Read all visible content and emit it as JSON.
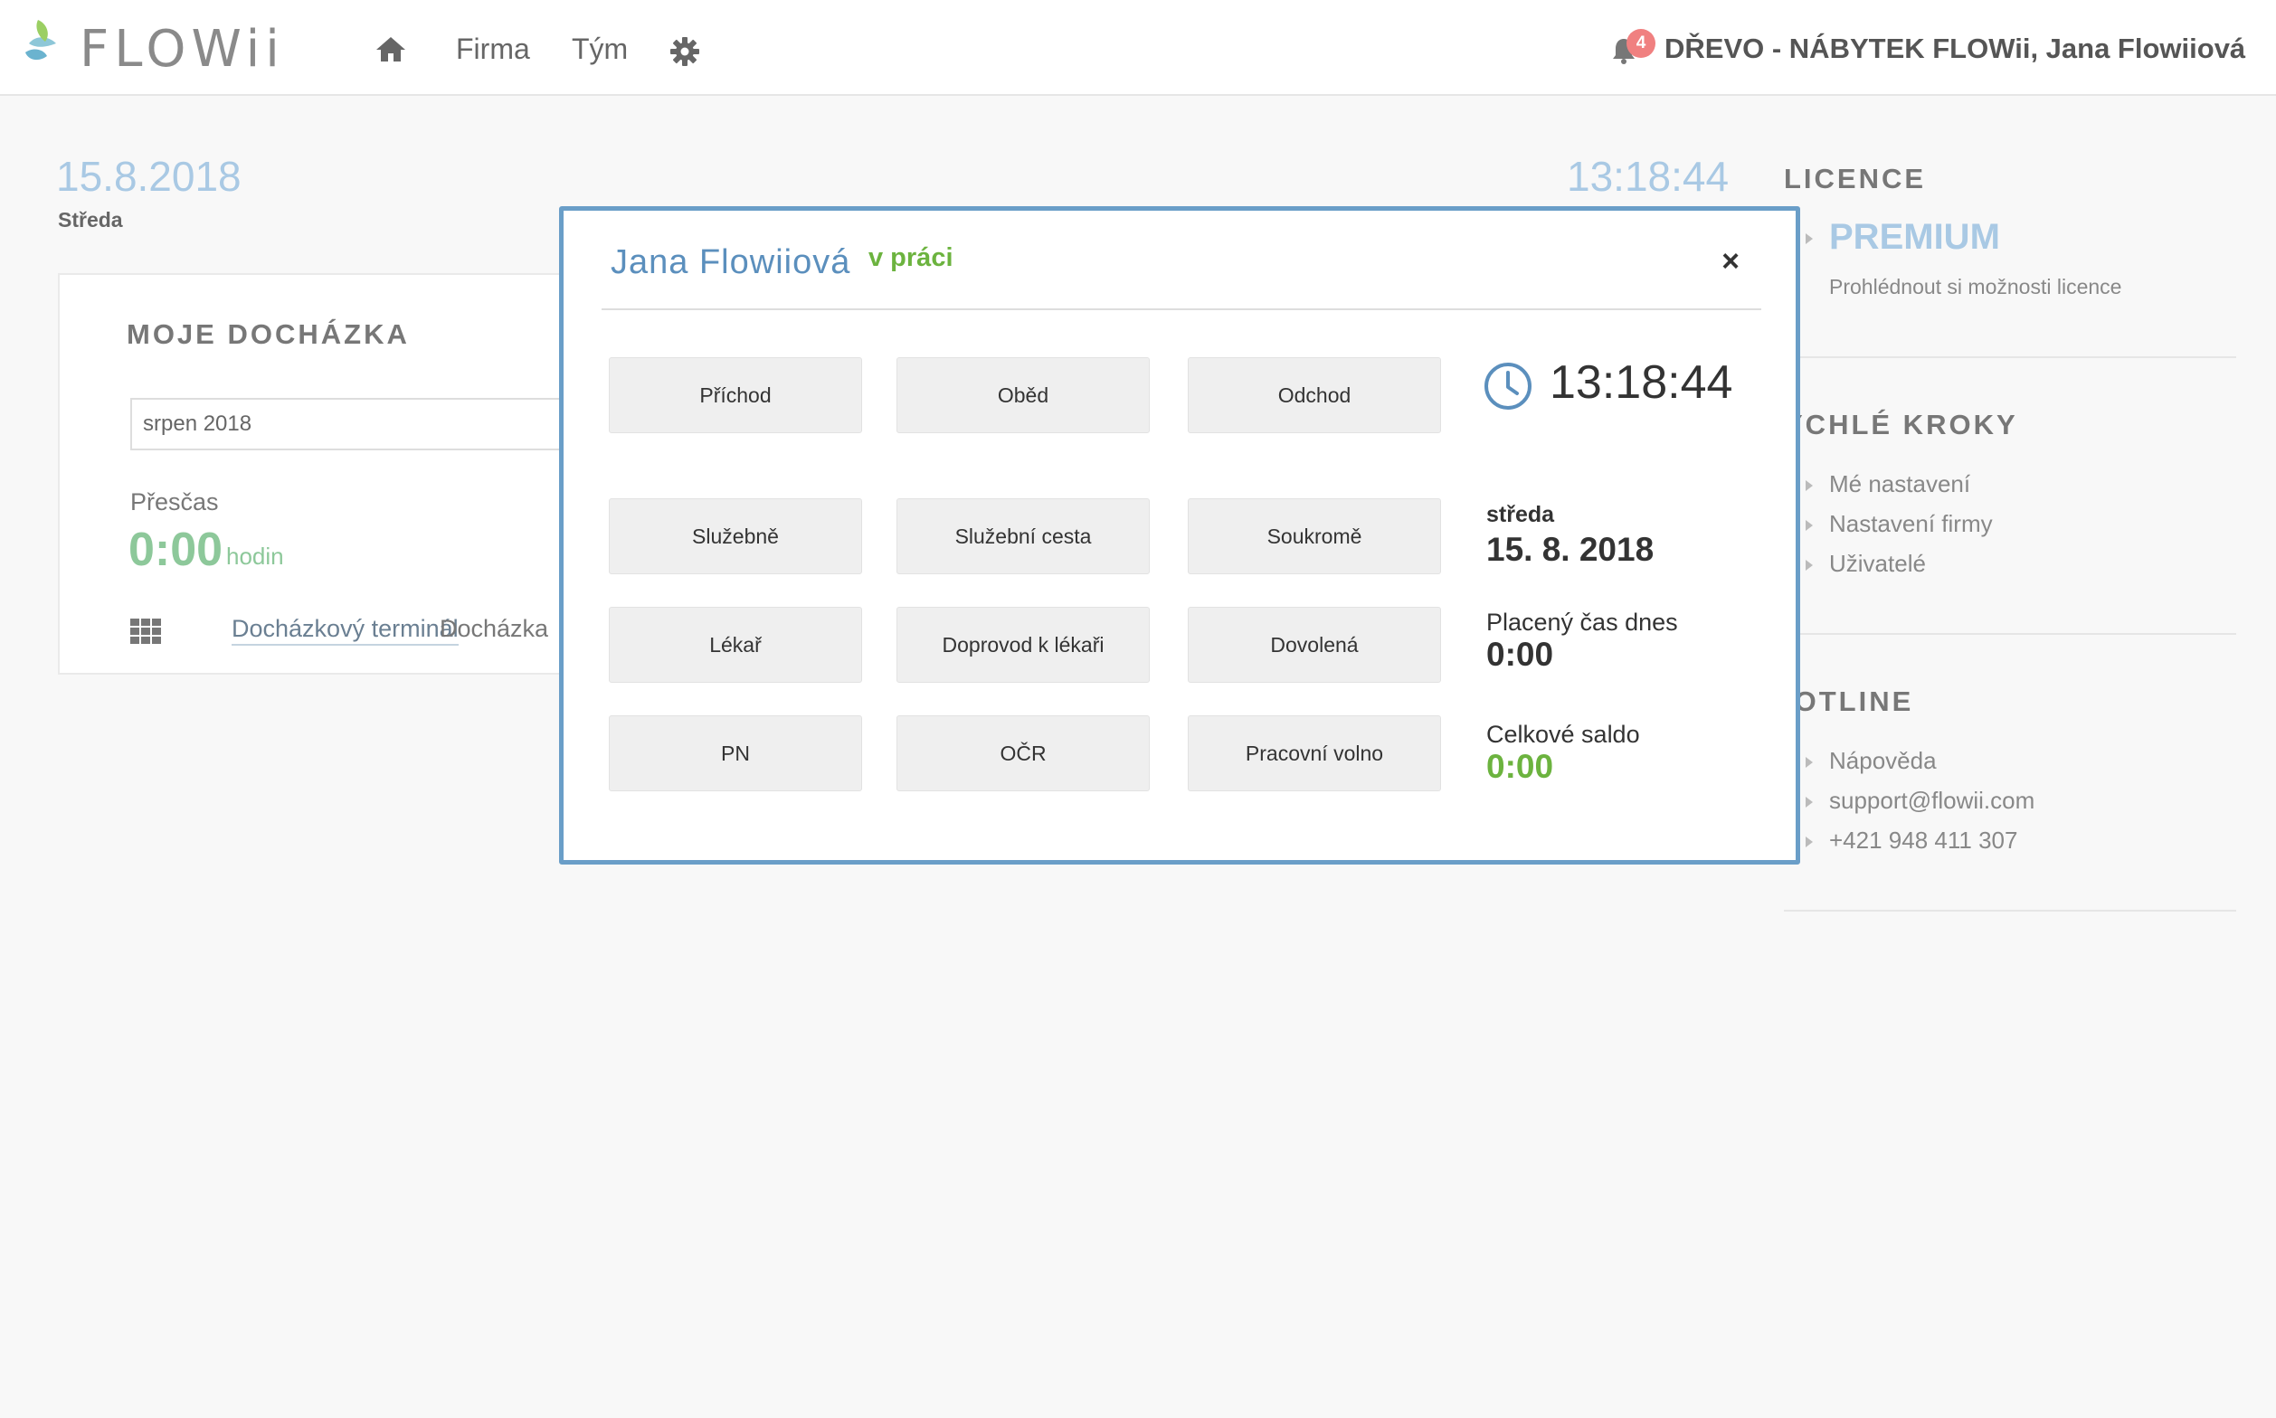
{
  "header": {
    "logo_text": "FLOWii",
    "nav": {
      "firma": "Firma",
      "tym": "Tým"
    },
    "notifications_count": "4",
    "company_user": "DŘEVO - NÁBYTEK FLOWii, Jana Flowiiová"
  },
  "dashboard": {
    "date": "15.8.2018",
    "weekday": "Středa",
    "time": "13:18:44",
    "attendance": {
      "title": "MOJE DOCHÁZKA",
      "month_value": "srpen 2018",
      "overtime_label": "Přesčas",
      "overtime_value": "0:00",
      "overtime_unit": "hodin",
      "terminal_link": "Docházkový terminál",
      "attendance_link": "Docházka"
    }
  },
  "sidebar": {
    "licence_title": "LICENCE",
    "licence_plan": "PREMIUM",
    "licence_link": "Prohlédnout si možnosti licence",
    "quick_title": "YCHLÉ KROKY",
    "quick_items": [
      "Mé nastavení",
      "Nastavení firmy",
      "Uživatelé"
    ],
    "hotline_title": "IOTLINE",
    "hotline_items": [
      "Nápověda",
      "support@flowii.com",
      "+421 948 411 307"
    ]
  },
  "modal": {
    "user_name": "Jana Flowiiová",
    "status": "v práci",
    "close": "×",
    "buttons": {
      "prichod": "Příchod",
      "obed": "Oběd",
      "odchod": "Odchod",
      "sluzebne": "Služebně",
      "sluzebni_cesta": "Služební cesta",
      "soukrome": "Soukromě",
      "lekar": "Lékař",
      "doprovod": "Doprovod k lékaři",
      "dovolena": "Dovolená",
      "pn": "PN",
      "ocr": "OČR",
      "pracovni_volno": "Pracovní volno"
    },
    "clock_time": "13:18:44",
    "weekday": "středa",
    "date": "15. 8. 2018",
    "paid_time_label": "Placený čas dnes",
    "paid_time_value": "0:00",
    "balance_label": "Celkové saldo",
    "balance_value": "0:00"
  },
  "colors": {
    "accent_blue": "#5b8fbd",
    "light_blue": "#a9c9e4",
    "status_green": "#6cb33f",
    "modal_border": "#6a9ec8",
    "badge": "#f08080"
  },
  "icons": [
    "logo-drop-icon",
    "home-icon",
    "gear-icon",
    "bell-icon",
    "grid-icon",
    "clock-icon",
    "close-icon",
    "triangle-bullet-icon"
  ]
}
